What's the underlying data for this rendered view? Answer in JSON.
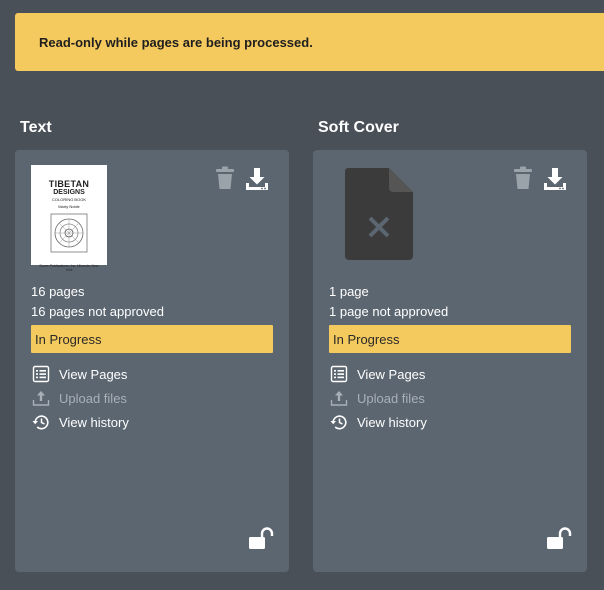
{
  "banner": {
    "message": "Read-only while pages are being processed."
  },
  "cards": [
    {
      "title": "Text",
      "thumbnail": {
        "line1": "TIBETAN",
        "line2": "DESIGNS",
        "line3": "COLORING BOOK",
        "line4": "Marty Noble",
        "line5": "Dover Publications, Inc. Mineola, New York"
      },
      "pages": "16 pages",
      "not_approved": "16 pages not approved",
      "status": "In Progress",
      "actions": {
        "view_pages": "View Pages",
        "upload_files": "Upload files",
        "view_history": "View history"
      }
    },
    {
      "title": "Soft Cover",
      "pages": "1 page",
      "not_approved": "1 page not approved",
      "status": "In Progress",
      "actions": {
        "view_pages": "View Pages",
        "upload_files": "Upload files",
        "view_history": "View history"
      }
    }
  ],
  "icons": {
    "delete": "trash-icon",
    "download": "download-icon",
    "view_pages": "list-icon",
    "upload": "upload-icon",
    "history": "history-icon",
    "lock": "unlock-icon",
    "missing_file": "file-missing-icon"
  },
  "colors": {
    "background": "#4a5058",
    "card": "#5c6670",
    "accent": "#f4c95d",
    "text": "#ffffff",
    "disabled_text": "#a8b0b8",
    "icon_muted": "#9aa2aa"
  }
}
